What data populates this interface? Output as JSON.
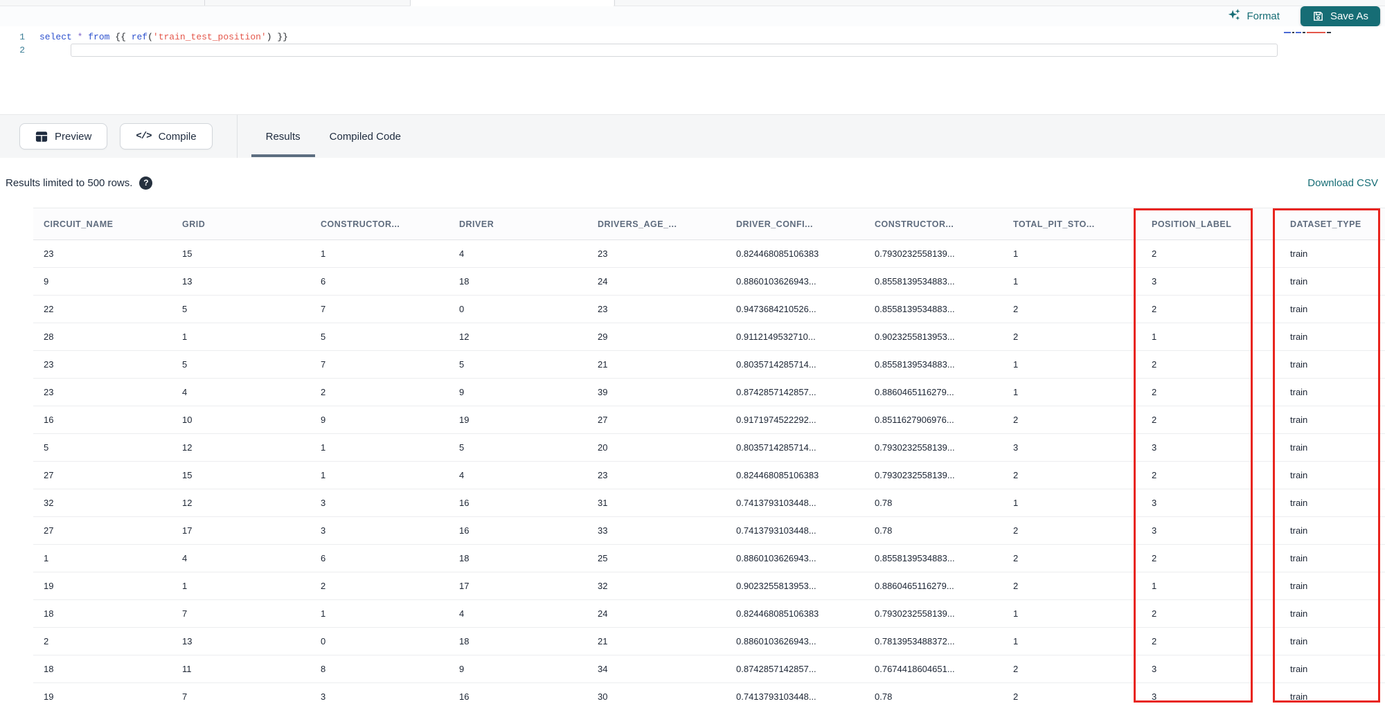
{
  "colors": {
    "teal_accent": "#166d75",
    "highlight_red": "#e8241d"
  },
  "toolbar": {
    "format_label": "Format",
    "save_as_label": "Save As"
  },
  "editor": {
    "code_text": "select * from {{ ref('train_test_position') }}",
    "lines": [
      {
        "number": "1"
      },
      {
        "number": "2"
      }
    ],
    "code_tokens": [
      [
        "select",
        "kw"
      ],
      [
        " ",
        "plain"
      ],
      [
        "*",
        "star"
      ],
      [
        " ",
        "plain"
      ],
      [
        "from",
        "kw"
      ],
      [
        " {{ ",
        "plain"
      ],
      [
        "ref",
        "fn"
      ],
      [
        "(",
        "plain"
      ],
      [
        "'train_test_position'",
        "str"
      ],
      [
        ")",
        "plain"
      ],
      [
        " }}",
        "plain"
      ]
    ]
  },
  "actionbar": {
    "preview_label": "Preview",
    "compile_label": "Compile",
    "compile_icon": "</>",
    "tabs": [
      {
        "label": "Results",
        "active": true
      },
      {
        "label": "Compiled Code",
        "active": false
      }
    ]
  },
  "results": {
    "limit_note": "Results limited to 500 rows.",
    "help_icon": "?",
    "download_csv_label": "Download CSV"
  },
  "table": {
    "columns": [
      "CIRCUIT_NAME",
      "GRID",
      "CONSTRUCTOR...",
      "DRIVER",
      "DRIVERS_AGE_...",
      "DRIVER_CONFI...",
      "CONSTRUCTOR...",
      "TOTAL_PIT_STO...",
      "POSITION_LABEL",
      "DATASET_TYPE"
    ],
    "highlighted_columns": [
      "POSITION_LABEL",
      "DATASET_TYPE"
    ],
    "rows": [
      [
        "23",
        "15",
        "1",
        "4",
        "23",
        "0.824468085106383",
        "0.7930232558139...",
        "1",
        "2",
        "train"
      ],
      [
        "9",
        "13",
        "6",
        "18",
        "24",
        "0.8860103626943...",
        "0.8558139534883...",
        "1",
        "3",
        "train"
      ],
      [
        "22",
        "5",
        "7",
        "0",
        "23",
        "0.9473684210526...",
        "0.8558139534883...",
        "2",
        "2",
        "train"
      ],
      [
        "28",
        "1",
        "5",
        "12",
        "29",
        "0.9112149532710...",
        "0.9023255813953...",
        "2",
        "1",
        "train"
      ],
      [
        "23",
        "5",
        "7",
        "5",
        "21",
        "0.8035714285714...",
        "0.8558139534883...",
        "1",
        "2",
        "train"
      ],
      [
        "23",
        "4",
        "2",
        "9",
        "39",
        "0.8742857142857...",
        "0.8860465116279...",
        "1",
        "2",
        "train"
      ],
      [
        "16",
        "10",
        "9",
        "19",
        "27",
        "0.9171974522292...",
        "0.8511627906976...",
        "2",
        "2",
        "train"
      ],
      [
        "5",
        "12",
        "1",
        "5",
        "20",
        "0.8035714285714...",
        "0.7930232558139...",
        "3",
        "3",
        "train"
      ],
      [
        "27",
        "15",
        "1",
        "4",
        "23",
        "0.824468085106383",
        "0.7930232558139...",
        "2",
        "2",
        "train"
      ],
      [
        "32",
        "12",
        "3",
        "16",
        "31",
        "0.7413793103448...",
        "0.78",
        "1",
        "3",
        "train"
      ],
      [
        "27",
        "17",
        "3",
        "16",
        "33",
        "0.7413793103448...",
        "0.78",
        "2",
        "3",
        "train"
      ],
      [
        "1",
        "4",
        "6",
        "18",
        "25",
        "0.8860103626943...",
        "0.8558139534883...",
        "2",
        "2",
        "train"
      ],
      [
        "19",
        "1",
        "2",
        "17",
        "32",
        "0.9023255813953...",
        "0.8860465116279...",
        "2",
        "1",
        "train"
      ],
      [
        "18",
        "7",
        "1",
        "4",
        "24",
        "0.824468085106383",
        "0.7930232558139...",
        "1",
        "2",
        "train"
      ],
      [
        "2",
        "13",
        "0",
        "18",
        "21",
        "0.8860103626943...",
        "0.7813953488372...",
        "1",
        "2",
        "train"
      ],
      [
        "18",
        "11",
        "8",
        "9",
        "34",
        "0.8742857142857...",
        "0.7674418604651...",
        "2",
        "3",
        "train"
      ],
      [
        "19",
        "7",
        "3",
        "16",
        "30",
        "0.7413793103448...",
        "0.78",
        "2",
        "3",
        "train"
      ]
    ]
  }
}
